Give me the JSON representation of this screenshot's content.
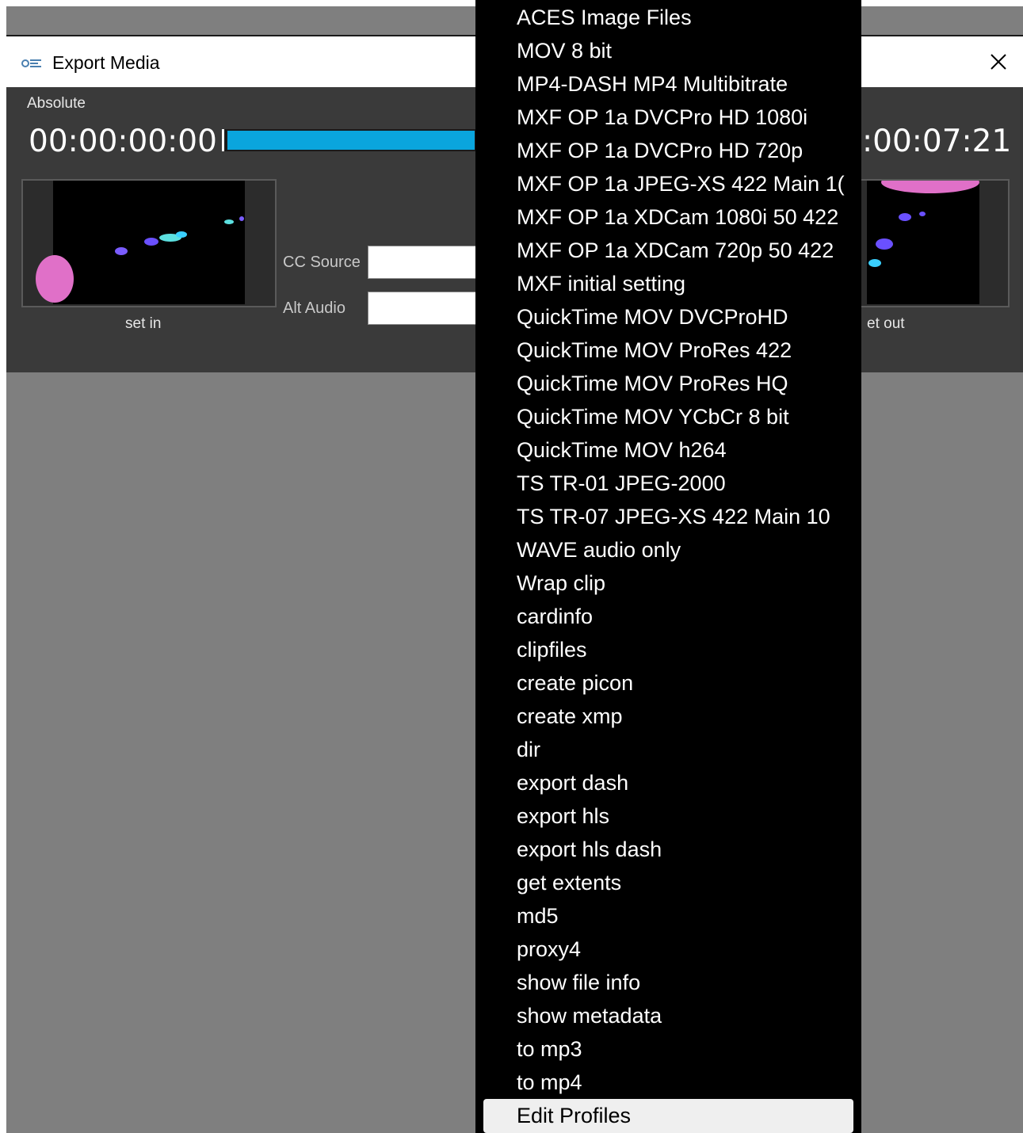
{
  "window": {
    "title": "Export Media",
    "close_glyph": "✕",
    "logo_icon": "app-logo-icon"
  },
  "timecode": {
    "mode_label": "Absolute",
    "in_value": "00:00:00:00",
    "out_value_visible": ":00:07:21",
    "progress_fraction": 0.97,
    "progress_color": "#0aa5dd"
  },
  "thumbnails": {
    "in_caption": "set in",
    "out_caption_visible": "et out"
  },
  "fields": {
    "cc_source_label": "CC Source",
    "cc_source_value": "",
    "alt_audio_label": "Alt Audio",
    "alt_audio_value": ""
  },
  "menu": {
    "items": [
      "ACES Image Files",
      "MOV 8 bit",
      "MP4-DASH MP4 Multibitrate",
      "MXF OP 1a DVCPro HD 1080i",
      "MXF OP 1a DVCPro HD 720p",
      "MXF OP 1a JPEG-XS 422 Main 1(",
      "MXF OP 1a XDCam 1080i 50 422",
      "MXF OP 1a XDCam 720p 50 422",
      "MXF initial setting",
      "QuickTime MOV DVCProHD",
      "QuickTime MOV ProRes 422",
      "QuickTime MOV ProRes HQ",
      "QuickTime MOV YCbCr 8 bit",
      "QuickTime MOV h264",
      "TS TR-01 JPEG-2000",
      "TS TR-07 JPEG-XS 422 Main 10",
      "WAVE audio only",
      "Wrap clip",
      "cardinfo",
      "clipfiles",
      "create picon",
      "create xmp",
      "dir",
      "export dash",
      "export hls",
      "export hls dash",
      "get extents",
      "md5",
      "proxy4",
      "show file info",
      "show metadata",
      "to mp3",
      "to mp4"
    ],
    "edit_profiles_label": "Edit Profiles"
  }
}
